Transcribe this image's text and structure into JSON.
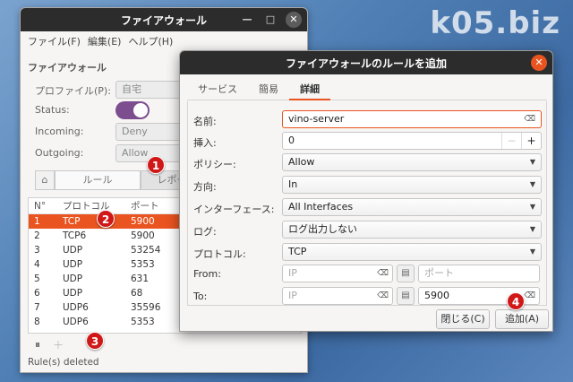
{
  "watermark": "k05.biz",
  "main": {
    "title": "ファイアウォール",
    "menu": [
      "ファイル(F)",
      "編集(E)",
      "ヘルプ(H)"
    ],
    "section_title": "ファイアウォール",
    "profile_label": "プロファイル(P):",
    "profile_value": "自宅",
    "status_label": "Status:",
    "incoming_label": "Incoming:",
    "incoming_value": "Deny",
    "outgoing_label": "Outgoing:",
    "outgoing_value": "Allow",
    "tab_rule": "ルール",
    "tab_report": "レポー",
    "columns": [
      "N°",
      "プロトコル",
      "ポート"
    ],
    "rows": [
      {
        "n": "1",
        "proto": "TCP",
        "port": "5900"
      },
      {
        "n": "2",
        "proto": "TCP6",
        "port": "5900"
      },
      {
        "n": "3",
        "proto": "UDP",
        "port": "53254"
      },
      {
        "n": "4",
        "proto": "UDP",
        "port": "5353"
      },
      {
        "n": "5",
        "proto": "UDP",
        "port": "631"
      },
      {
        "n": "6",
        "proto": "UDP",
        "port": "68"
      },
      {
        "n": "7",
        "proto": "UDP6",
        "port": "35596"
      },
      {
        "n": "8",
        "proto": "UDP6",
        "port": "5353"
      }
    ],
    "status_text": "Rule(s) deleted"
  },
  "dialog": {
    "title": "ファイアウォールのルールを追加",
    "tabs": [
      "サービス",
      "簡易",
      "詳細"
    ],
    "name_label": "名前:",
    "name_value": "vino-server",
    "insert_label": "挿入:",
    "insert_value": "0",
    "policy_label": "ポリシー:",
    "policy_value": "Allow",
    "direction_label": "方向:",
    "direction_value": "In",
    "interface_label": "インターフェース:",
    "interface_value": "All Interfaces",
    "log_label": "ログ:",
    "log_value": "ログ出力しない",
    "protocol_label": "プロトコル:",
    "protocol_value": "TCP",
    "from_label": "From:",
    "from_ip_placeholder": "IP",
    "from_port_placeholder": "ポート",
    "to_label": "To:",
    "to_ip_placeholder": "IP",
    "to_port_value": "5900",
    "close_button": "閉じる(C)",
    "add_button": "追加(A)"
  },
  "badges": [
    "1",
    "2",
    "3",
    "4"
  ],
  "colors": {
    "accent": "#e95420",
    "toggle": "#7c4d8f",
    "badge": "#d01818"
  }
}
